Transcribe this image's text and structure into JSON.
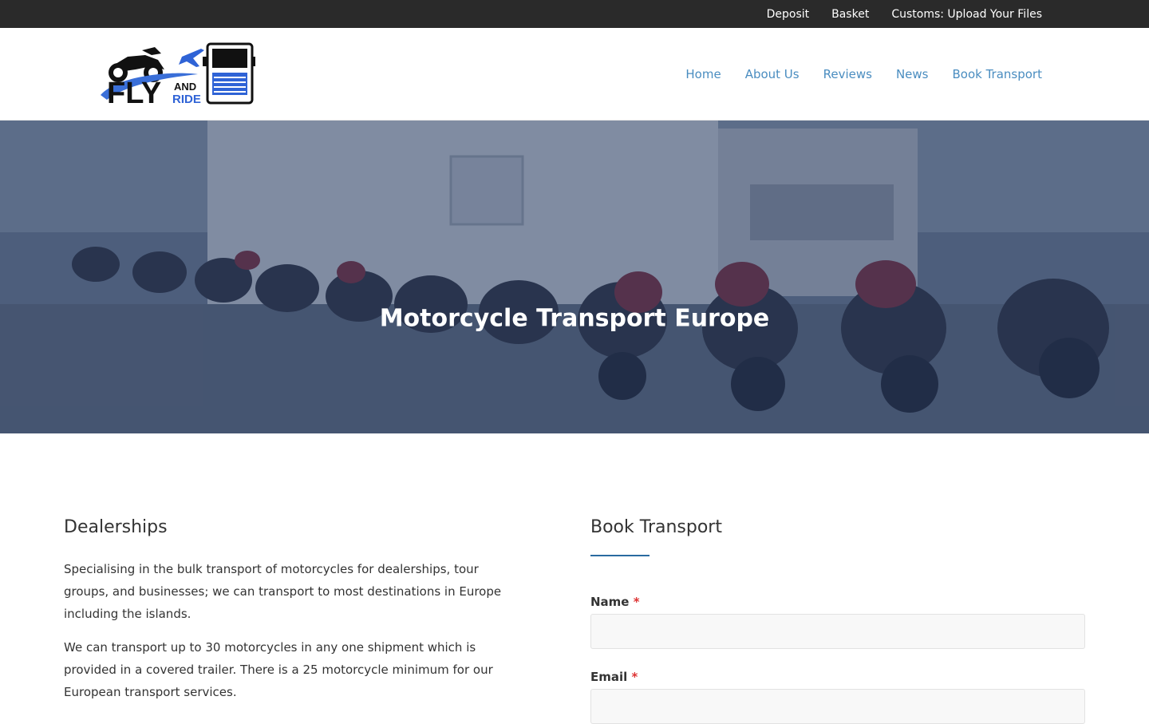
{
  "topbar": {
    "links": [
      "Deposit",
      "Basket",
      "Customs: Upload Your Files"
    ]
  },
  "logo": {
    "text_fly": "FLY",
    "text_and": "AND",
    "text_ride": "RIDE"
  },
  "nav": {
    "items": [
      "Home",
      "About Us",
      "Reviews",
      "News",
      "Book Transport"
    ]
  },
  "hero": {
    "title": "Motorcycle Transport Europe"
  },
  "dealerships": {
    "heading": "Dealerships",
    "paragraphs": [
      "Specialising in the bulk transport of motorcycles for dealerships, tour groups, and businesses; we can transport to most destinations in Europe including the islands.",
      "We can transport up to 30 motorcycles in any one shipment which is provided in a covered trailer. There is a 25 motorcycle minimum for our European transport services."
    ]
  },
  "form": {
    "heading": "Book Transport",
    "fields": [
      {
        "label": "Name",
        "required_mark": "*",
        "value": ""
      },
      {
        "label": "Email",
        "required_mark": "*",
        "value": ""
      }
    ]
  },
  "colors": {
    "nav_link": "#4a8dc0",
    "topbar_bg": "#2a2a2a",
    "accent_underline": "#2a6aa0",
    "required": "#dd3333"
  }
}
